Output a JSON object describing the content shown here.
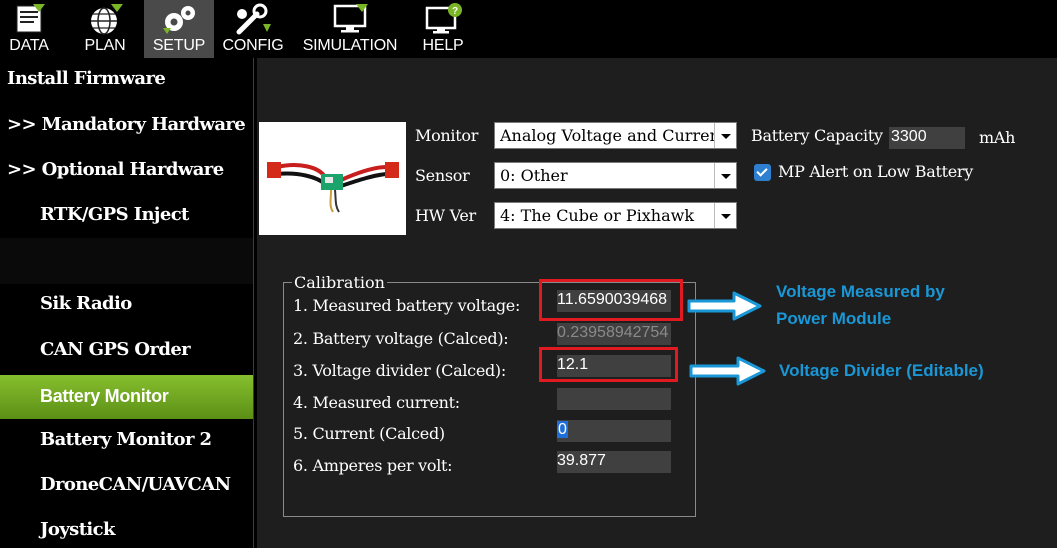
{
  "toolbar": {
    "items": [
      {
        "label": "DATA",
        "icon": "data-icon"
      },
      {
        "label": "PLAN",
        "icon": "plan-globe-icon"
      },
      {
        "label": "SETUP",
        "icon": "setup-gears-icon"
      },
      {
        "label": "CONFIG",
        "icon": "config-wrench-icon"
      },
      {
        "label": "SIMULATION",
        "icon": "simulation-monitor-icon"
      },
      {
        "label": "HELP",
        "icon": "help-monitor-icon"
      }
    ],
    "active": "SETUP"
  },
  "sidebar": {
    "items": [
      "Install Firmware",
      ">> Mandatory Hardware",
      ">> Optional Hardware",
      "RTK/GPS Inject",
      "Sik Radio",
      "CAN GPS Order",
      "Battery Monitor",
      "Battery Monitor 2",
      "DroneCAN/UAVCAN",
      "Joystick"
    ],
    "active": "Battery Monitor"
  },
  "monitor": {
    "monitor_label": "Monitor",
    "monitor_value": "Analog Voltage and Current",
    "sensor_label": "Sensor",
    "sensor_value": "0: Other",
    "hwver_label": "HW Ver",
    "hwver_value": "4: The Cube or Pixhawk",
    "capacity_label": "Battery Capacity",
    "capacity_value": "3300",
    "capacity_unit": "mAh",
    "alert_label": "MP Alert on Low Battery",
    "alert_checked": true
  },
  "calibration": {
    "title": "Calibration",
    "rows": [
      {
        "label": "1. Measured battery voltage:",
        "value": "11.6590039468"
      },
      {
        "label": "2. Battery voltage (Calced):",
        "value": "0.23958942754"
      },
      {
        "label": "3. Voltage divider (Calced):",
        "value": "12.1"
      },
      {
        "label": "4. Measured current:",
        "value": ""
      },
      {
        "label": "5. Current (Calced)",
        "value": "0"
      },
      {
        "label": "6. Amperes per volt:",
        "value": "39.877"
      }
    ]
  },
  "annotations": {
    "voltage_measured": [
      "Voltage Measured by",
      "Power Module"
    ],
    "voltage_divider": "Voltage Divider (Editable)"
  },
  "colors": {
    "highlight_red": "#e01a20",
    "annotation_blue": "#1a97d6",
    "active_green": "#7ab526"
  }
}
